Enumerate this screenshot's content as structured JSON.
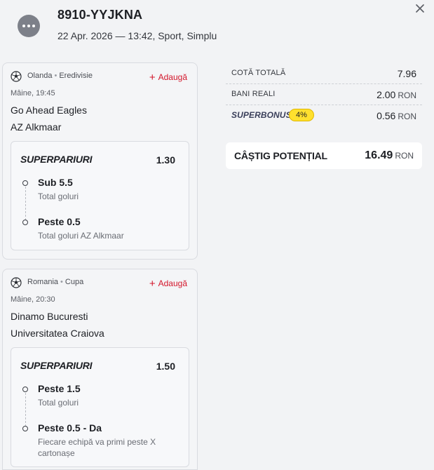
{
  "header": {
    "ticket_id": "8910-YYJKNA",
    "meta": "22 Apr. 2026 — 13:42, Sport, Simplu"
  },
  "events": [
    {
      "country": "Olanda",
      "league": "Eredivisie",
      "add_label": "Adaugă",
      "time": "Mâine, 19:45",
      "home": "Go Ahead Eagles",
      "away": "AZ Alkmaar",
      "bet_type": "SUPERPARIURI",
      "odd": "1.30",
      "selections": [
        {
          "name": "Sub 5.5",
          "market": "Total goluri"
        },
        {
          "name": "Peste 0.5",
          "market": "Total goluri AZ Alkmaar"
        }
      ]
    },
    {
      "country": "Romania",
      "league": "Cupa",
      "add_label": "Adaugă",
      "time": "Mâine, 20:30",
      "home": "Dinamo Bucuresti",
      "away": "Universitatea Craiova",
      "bet_type": "SUPERPARIURI",
      "odd": "1.50",
      "selections": [
        {
          "name": "Peste 1.5",
          "market": "Total goluri"
        },
        {
          "name": "Peste 0.5 - Da",
          "market": "Fiecare echipă va primi peste X cartonașe"
        }
      ]
    }
  ],
  "summary": {
    "total_odds_label": "COTĂ TOTALĂ",
    "total_odds_value": "7.96",
    "stake_label": "BANI REALI",
    "stake_value": "2.00",
    "stake_currency": "RON",
    "superbonus_label": "SUPERBONUS",
    "superbonus_percent": "4%",
    "superbonus_value": "0.56",
    "superbonus_currency": "RON",
    "potential_label": "CÂȘTIG POTENȚIAL",
    "potential_value": "16.49",
    "potential_currency": "RON"
  },
  "colors": {
    "accent_red": "#d3162b",
    "badge_yellow": "#ffe02e"
  },
  "icons": {
    "more": "more-dots-icon",
    "close": "close-icon",
    "sport": "soccer-ball-icon",
    "add": "plus-icon"
  }
}
